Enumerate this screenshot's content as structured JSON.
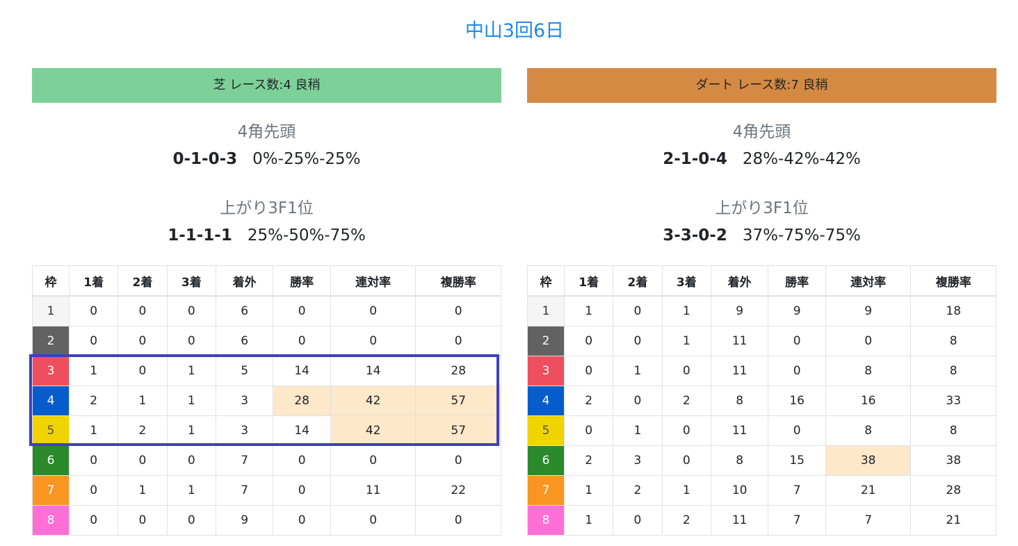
{
  "title": "中山3回6日",
  "headers": [
    "枠",
    "1着",
    "2着",
    "3着",
    "着外",
    "勝率",
    "連対率",
    "複勝率"
  ],
  "panels": [
    {
      "id": "turf",
      "banner": "芝 レース数:4  良稍",
      "banner_color": "#7dd098",
      "stat1_title": "4角先頭",
      "stat1_record": "0-1-0-3",
      "stat1_rates": "0%-25%-25%",
      "stat2_title": "上がり3F1位",
      "stat2_record": "1-1-1-1",
      "stat2_rates": "25%-50%-75%",
      "rows": [
        [
          "1",
          "0",
          "0",
          "0",
          "6",
          "0",
          "0",
          "0"
        ],
        [
          "2",
          "0",
          "0",
          "0",
          "6",
          "0",
          "0",
          "0"
        ],
        [
          "3",
          "1",
          "0",
          "1",
          "5",
          "14",
          "14",
          "28"
        ],
        [
          "4",
          "2",
          "1",
          "1",
          "3",
          "28",
          "42",
          "57"
        ],
        [
          "5",
          "1",
          "2",
          "1",
          "3",
          "14",
          "42",
          "57"
        ],
        [
          "6",
          "0",
          "0",
          "0",
          "7",
          "0",
          "0",
          "0"
        ],
        [
          "7",
          "0",
          "1",
          "1",
          "7",
          "0",
          "11",
          "22"
        ],
        [
          "8",
          "0",
          "0",
          "0",
          "9",
          "0",
          "0",
          "0"
        ]
      ],
      "highlights": [
        [
          3,
          5
        ],
        [
          3,
          6
        ],
        [
          3,
          7
        ],
        [
          4,
          6
        ],
        [
          4,
          7
        ]
      ]
    },
    {
      "id": "dirt",
      "banner": "ダート レース数:7  良稍",
      "banner_color": "#d48a43",
      "stat1_title": "4角先頭",
      "stat1_record": "2-1-0-4",
      "stat1_rates": "28%-42%-42%",
      "stat2_title": "上がり3F1位",
      "stat2_record": "3-3-0-2",
      "stat2_rates": "37%-75%-75%",
      "rows": [
        [
          "1",
          "1",
          "0",
          "1",
          "9",
          "9",
          "9",
          "18"
        ],
        [
          "2",
          "0",
          "0",
          "1",
          "11",
          "0",
          "0",
          "8"
        ],
        [
          "3",
          "0",
          "1",
          "0",
          "11",
          "0",
          "8",
          "8"
        ],
        [
          "4",
          "2",
          "0",
          "2",
          "8",
          "16",
          "16",
          "33"
        ],
        [
          "5",
          "0",
          "1",
          "0",
          "11",
          "0",
          "8",
          "8"
        ],
        [
          "6",
          "2",
          "3",
          "0",
          "8",
          "15",
          "38",
          "38"
        ],
        [
          "7",
          "1",
          "2",
          "1",
          "10",
          "7",
          "21",
          "28"
        ],
        [
          "8",
          "1",
          "0",
          "2",
          "11",
          "7",
          "7",
          "21"
        ]
      ],
      "highlights": [
        [
          5,
          6
        ]
      ]
    }
  ]
}
